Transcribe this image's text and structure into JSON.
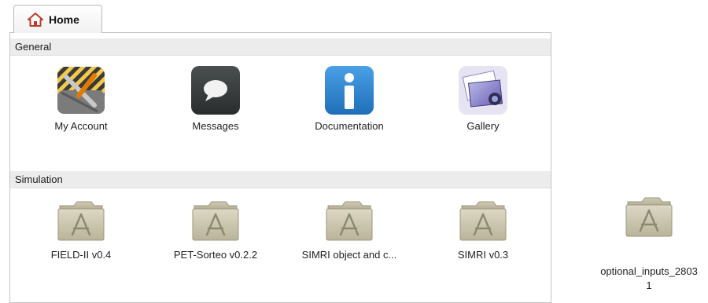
{
  "tab": {
    "label": "Home",
    "icon": "house-icon"
  },
  "sections": {
    "general": {
      "title": "General",
      "items": [
        {
          "label": "My Account",
          "icon": "tools-icon"
        },
        {
          "label": "Messages",
          "icon": "speech-bubble-icon"
        },
        {
          "label": "Documentation",
          "icon": "info-icon"
        },
        {
          "label": "Gallery",
          "icon": "photos-icon"
        }
      ]
    },
    "simulation": {
      "title": "Simulation",
      "items": [
        {
          "label": "FIELD-II v0.4",
          "icon": "applications-folder-icon"
        },
        {
          "label": "PET-Sorteo v0.2.2",
          "icon": "applications-folder-icon"
        },
        {
          "label": "SIMRI object and c...",
          "icon": "applications-folder-icon"
        },
        {
          "label": "SIMRI v0.3",
          "icon": "applications-folder-icon"
        }
      ]
    }
  },
  "desktop_item": {
    "label_line1": "optional_inputs_2803",
    "label_line2": "1",
    "icon": "applications-folder-icon"
  }
}
